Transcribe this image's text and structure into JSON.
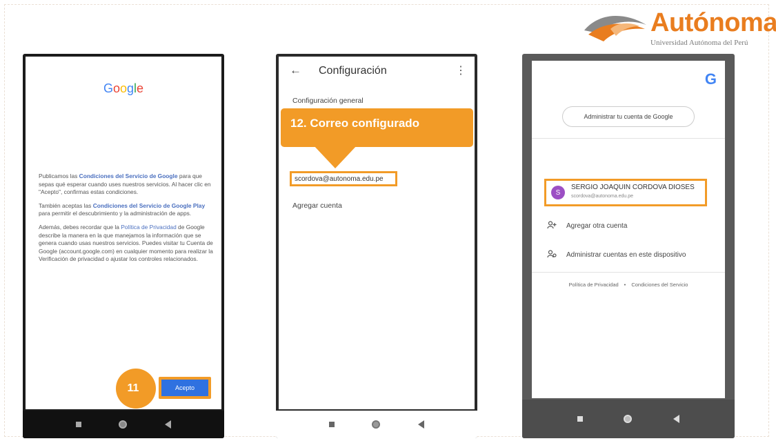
{
  "logo": {
    "name": "Autónoma",
    "subtitle": "Universidad Autónoma del Perú",
    "colors": {
      "orange": "#e97d1f",
      "gray": "#7b7b7b"
    }
  },
  "phone1": {
    "google_logo": "Google",
    "terms": {
      "p1_a": "Publicamos las ",
      "p1_link": "Condiciones del Servicio de Google",
      "p1_b": " para que sepas qué esperar cuando uses nuestros servicios. Al hacer clic en \"Acepto\", confirmas estas condiciones.",
      "p2_a": "También aceptas las ",
      "p2_link": "Condiciones del Servicio de Google Play",
      "p2_b": " para permitir el descubrimiento y la administración de apps.",
      "p3_a": "Además, debes recordar que la ",
      "p3_link": "Política de Privacidad",
      "p3_b": " de Google describe la manera en la que manejamos la información que se genera cuando usas nuestros servicios. Puedes visitar tu Cuenta de Google (account.google.com) en cualquier momento para realizar la Verificación de privacidad o ajustar los controles relacionados."
    },
    "step_number": "11",
    "accept_button": "Acepto"
  },
  "phone2": {
    "back_icon": "arrow-left-icon",
    "title": "Configuración",
    "menu_icon": "kebab-menu-icon",
    "section": "Configuración general",
    "callout_number": "12.",
    "callout_text": "Correo configurado",
    "email": "scordova@autonoma.edu.pe",
    "add_account": "Agregar cuenta"
  },
  "phone3": {
    "g_logo": "G",
    "manage_button": "Administrar tu cuenta de Google",
    "account": {
      "initial": "S",
      "name": "SERGIO JOAQUIN CORDOVA DIOSES",
      "email": "scordova@autonoma.edu.pe"
    },
    "add_other": "Agregar otra cuenta",
    "manage_device": "Administrar cuentas en este dispositivo",
    "privacy": "Política de Privacidad",
    "terms": "Condiciones del Servicio"
  },
  "accent_color": "#f29b27"
}
